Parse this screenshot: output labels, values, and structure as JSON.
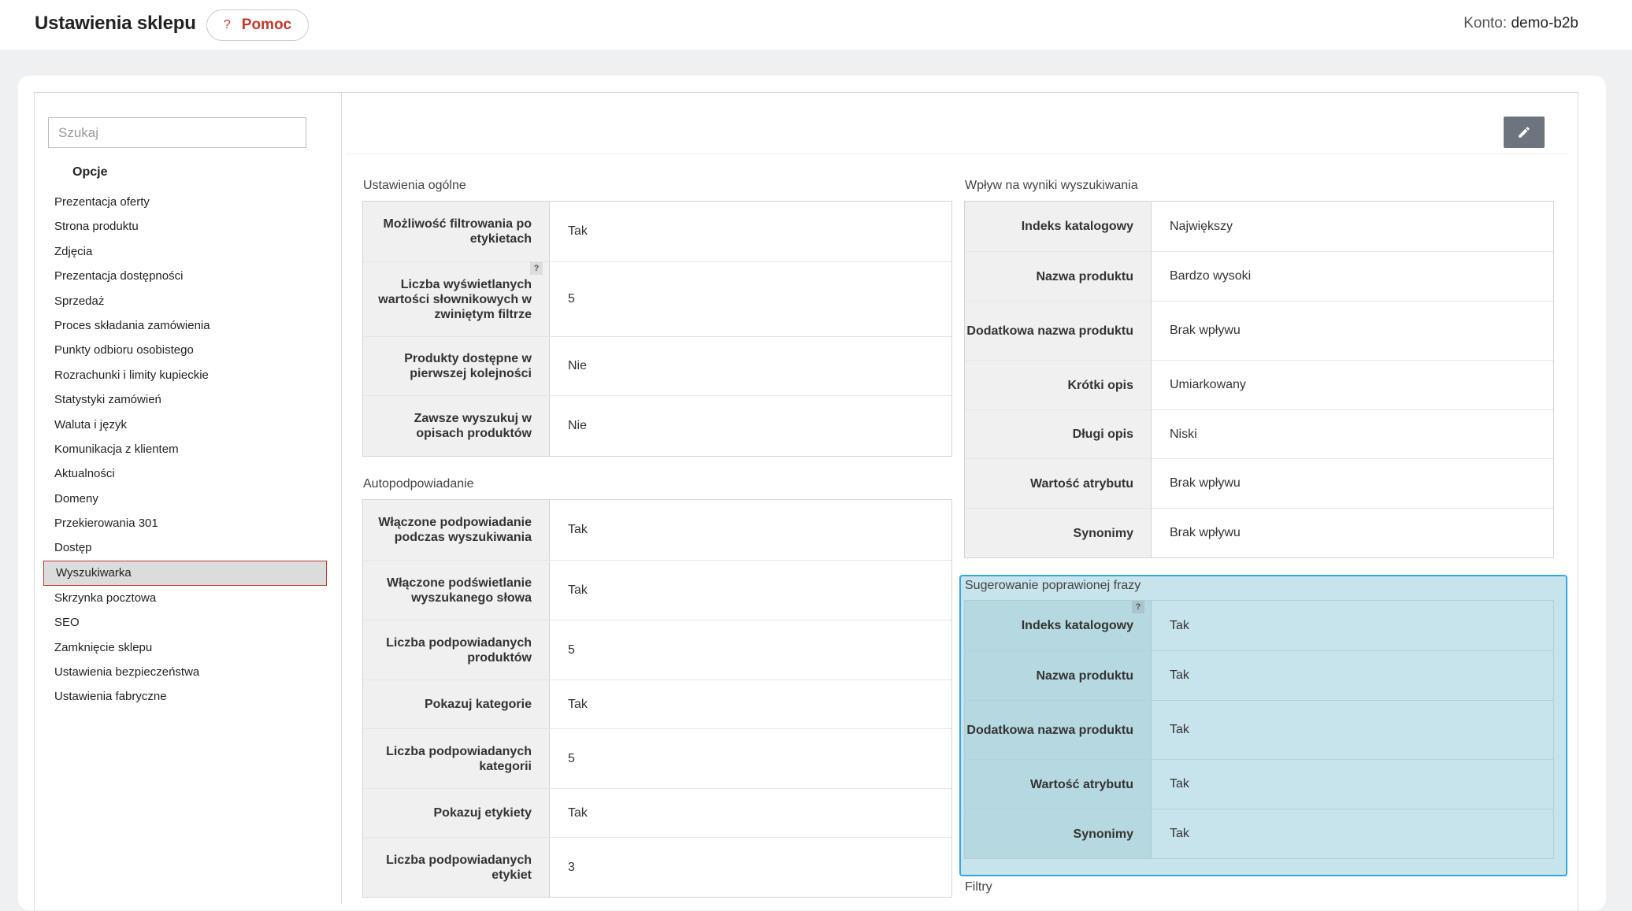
{
  "header": {
    "title": "Ustawienia sklepu",
    "help_icon": "?",
    "help_label": "Pomoc",
    "account_label": "Konto:",
    "account_value": "demo-b2b"
  },
  "sidebar": {
    "search_placeholder": "Szukaj",
    "section_title": "Opcje",
    "items": [
      {
        "label": "Prezentacja oferty"
      },
      {
        "label": "Strona produktu"
      },
      {
        "label": "Zdjęcia"
      },
      {
        "label": "Prezentacja dostępności"
      },
      {
        "label": "Sprzedaż"
      },
      {
        "label": "Proces składania zamówienia"
      },
      {
        "label": "Punkty odbioru osobistego"
      },
      {
        "label": "Rozrachunki i limity kupieckie"
      },
      {
        "label": "Statystyki zamówień"
      },
      {
        "label": "Waluta i język"
      },
      {
        "label": "Komunikacja z klientem"
      },
      {
        "label": "Aktualności"
      },
      {
        "label": "Domeny"
      },
      {
        "label": "Przekierowania 301"
      },
      {
        "label": "Dostęp"
      },
      {
        "label": "Wyszukiwarka",
        "active": true
      },
      {
        "label": "Skrzynka pocztowa"
      },
      {
        "label": "SEO"
      },
      {
        "label": "Zamknięcie sklepu"
      },
      {
        "label": "Ustawienia bezpieczeństwa"
      },
      {
        "label": "Ustawienia fabryczne"
      }
    ]
  },
  "toolbar": {
    "edit_icon": "pencil-icon"
  },
  "general": {
    "title": "Ustawienia ogólne",
    "rows": [
      {
        "label": "Możliwość filtrowania po etykietach",
        "value": "Tak"
      },
      {
        "label": "Liczba wyświetlanych wartości słownikowych w zwiniętym filtrze",
        "value": "5",
        "help": "?"
      },
      {
        "label": "Produkty dostępne w pierwszej kolejności",
        "value": "Nie"
      },
      {
        "label": "Zawsze wyszukuj w opisach produktów",
        "value": "Nie"
      }
    ]
  },
  "autocomplete": {
    "title": "Autopodpowiadanie",
    "rows": [
      {
        "label": "Włączone podpowiadanie podczas wyszukiwania",
        "value": "Tak"
      },
      {
        "label": "Włączone podświetlanie wyszukanego słowa",
        "value": "Tak"
      },
      {
        "label": "Liczba podpowiadanych produktów",
        "value": "5"
      },
      {
        "label": "Pokazuj kategorie",
        "value": "Tak"
      },
      {
        "label": "Liczba podpowiadanych kategorii",
        "value": "5"
      },
      {
        "label": "Pokazuj etykiety",
        "value": "Tak"
      },
      {
        "label": "Liczba podpowiadanych etykiet",
        "value": "3"
      }
    ]
  },
  "impact": {
    "title": "Wpływ na wyniki wyszukiwania",
    "rows": [
      {
        "label": "Indeks katalogowy",
        "value": "Największy"
      },
      {
        "label": "Nazwa produktu",
        "value": "Bardzo wysoki"
      },
      {
        "label": "Dodatkowa nazwa produktu",
        "value": "Brak wpływu"
      },
      {
        "label": "Krótki opis",
        "value": "Umiarkowany"
      },
      {
        "label": "Długi opis",
        "value": "Niski"
      },
      {
        "label": "Wartość atrybutu",
        "value": "Brak wpływu"
      },
      {
        "label": "Synonimy",
        "value": "Brak wpływu"
      }
    ]
  },
  "suggest": {
    "title": "Sugerowanie poprawionej frazy",
    "help": "?",
    "rows": [
      {
        "label": "Indeks katalogowy",
        "value": "Tak"
      },
      {
        "label": "Nazwa produktu",
        "value": "Tak"
      },
      {
        "label": "Dodatkowa nazwa produktu",
        "value": "Tak"
      },
      {
        "label": "Wartość atrybutu",
        "value": "Tak"
      },
      {
        "label": "Synonimy",
        "value": "Tak"
      }
    ]
  },
  "filters": {
    "title": "Filtry"
  }
}
